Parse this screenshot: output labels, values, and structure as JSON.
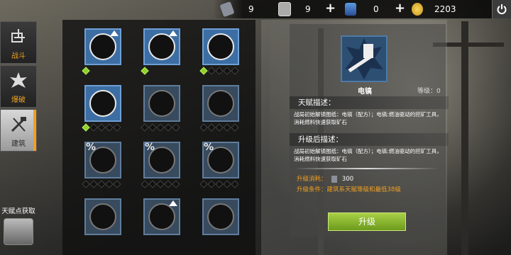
{
  "resources": [
    {
      "icon": "bolt-can-icon",
      "value": "9"
    },
    {
      "icon": "blueprint-card-icon",
      "value": "9"
    },
    {
      "icon": "crystal-card-icon",
      "value": "0"
    },
    {
      "icon": "gold-coin-icon",
      "value": "2203"
    }
  ],
  "sidebar": {
    "tabs": [
      {
        "label": "战斗",
        "icon": "crosshair-icon"
      },
      {
        "label": "爆破",
        "icon": "explosion-icon"
      },
      {
        "label": "建筑",
        "icon": "hammer-saw-icon"
      }
    ],
    "talent_get_label": "天赋点获取"
  },
  "nodes": [
    {
      "icon": "wood-up-icon",
      "dots": [
        true
      ],
      "bordered": true
    },
    {
      "icon": "stone-up-icon",
      "dots": [
        true
      ],
      "bordered": true
    },
    {
      "icon": "tools-icon",
      "dots": [
        true,
        false,
        false,
        false,
        false
      ],
      "bordered": true
    },
    {
      "icon": "medkit-icon",
      "dots": [
        true,
        false,
        false,
        false,
        false
      ],
      "bordered": true
    },
    {
      "icon": "chainsaw-icon",
      "dots": [
        false,
        false,
        false,
        false,
        false
      ],
      "bordered": false
    },
    {
      "icon": "wrench-flask-icon",
      "dots": [
        false,
        false,
        false,
        false,
        false
      ],
      "bordered": false
    },
    {
      "icon": "flask-gear-icon",
      "dots": [
        false,
        false,
        false,
        false,
        false
      ],
      "bordered": false,
      "pct": "%"
    },
    {
      "icon": "battery-icon",
      "dots": [
        false,
        false,
        false,
        false,
        false
      ],
      "bordered": false,
      "pct": "%"
    },
    {
      "icon": "wrench-screwdriver-icon",
      "dots": [
        false,
        false,
        false,
        false,
        false
      ],
      "bordered": false,
      "pct": "%"
    },
    {
      "icon": "skull-icon",
      "dots": [],
      "bordered": false
    },
    {
      "icon": "drill-up-icon",
      "dots": [],
      "bordered": false
    },
    {
      "icon": "electric-drill-icon",
      "dots": [],
      "bordered": false
    }
  ],
  "detail": {
    "name": "电镐",
    "level_text": "等级：0",
    "talent_desc_title": "天赋描述：",
    "talent_desc": "战局初始解锁图纸：电镐（配方）；电镐:燃油驱动的挖矿工具，消耗燃料快速获取矿石",
    "after_title": "升级后描述：",
    "after_desc": "战局初始解锁图纸：电镐（配方）；电镐:燃油驱动的挖矿工具，消耗燃料快速获取矿石",
    "cost_label": "升级消耗：",
    "cost_value": "300",
    "condition": "升级条件：建筑系天赋等级和最低38级",
    "upgrade_label": "升级"
  },
  "colors": {
    "accent": "#f0a020",
    "node_blue": "#3c6ea3",
    "dot_active": "#8fd12a",
    "button_green": "#8cb830"
  }
}
